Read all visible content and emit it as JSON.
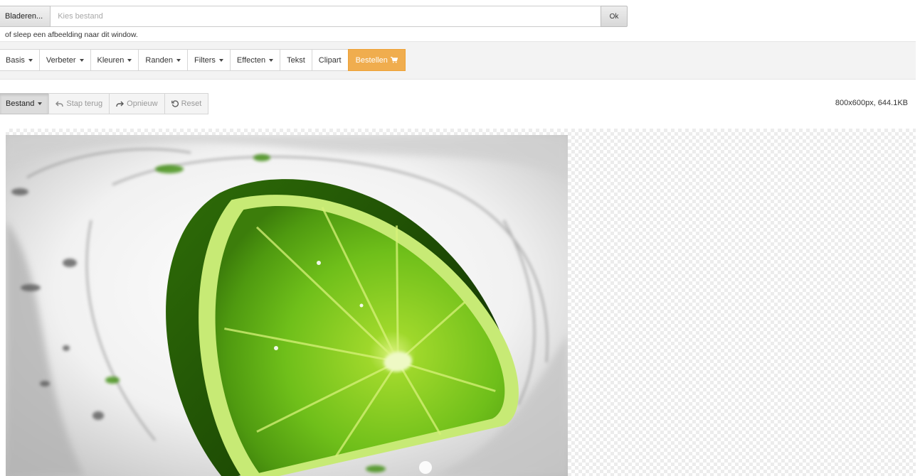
{
  "file_bar": {
    "browse_label": "Bladeren...",
    "file_placeholder": "Kies bestand",
    "ok_label": "Ok",
    "drop_hint": "of sleep een afbeelding naar dit window."
  },
  "menu": {
    "items": [
      {
        "label": "Basis",
        "dropdown": true
      },
      {
        "label": "Verbeter",
        "dropdown": true
      },
      {
        "label": "Kleuren",
        "dropdown": true
      },
      {
        "label": "Randen",
        "dropdown": true
      },
      {
        "label": "Filters",
        "dropdown": true
      },
      {
        "label": "Effecten",
        "dropdown": true
      },
      {
        "label": "Tekst",
        "dropdown": false
      },
      {
        "label": "Clipart",
        "dropdown": false
      }
    ],
    "order_label": "Bestellen",
    "order_icon": "cart-icon",
    "accent_color": "#f0ad4e"
  },
  "toolbar": {
    "file_label": "Bestand",
    "undo_label": "Stap terug",
    "undo_icon": "undo-icon",
    "redo_label": "Opnieuw",
    "redo_icon": "redo-icon",
    "reset_label": "Reset",
    "reset_icon": "reset-icon"
  },
  "image_info": "800x600px, 644.1KB",
  "canvas": {
    "image_subject": "lime slice splashing in water",
    "lime_color": "#6fbf1a"
  }
}
